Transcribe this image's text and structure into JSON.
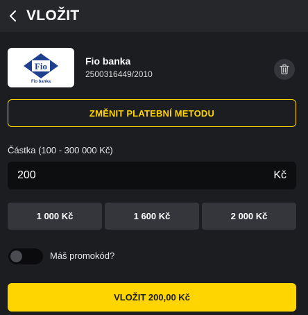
{
  "header": {
    "title": "VLOŽIT",
    "back_icon": "chevron-left-icon"
  },
  "payment_method": {
    "logo_text": "Fio",
    "logo_caption": "Fio banka",
    "bank_name": "Fio banka",
    "account_number": "2500316449/2010",
    "delete_icon": "trash-icon"
  },
  "change_method_label": "ZMĚNIT PLATEBNÍ METODU",
  "amount": {
    "label": "Částka (100 - 300 000 Kč)",
    "value": "200",
    "currency": "Kč"
  },
  "quick_amounts": [
    "1 000 Kč",
    "1 600 Kč",
    "2 000 Kč"
  ],
  "promo": {
    "label": "Máš promokód?",
    "enabled": false
  },
  "submit_label": "VLOŽIT 200,00 Kč",
  "colors": {
    "background": "#1c1d21",
    "header": "#26272b",
    "accent": "#ffd400",
    "button": "#34363b",
    "input": "#0d0e10",
    "fio_blue": "#1f3f8f"
  }
}
